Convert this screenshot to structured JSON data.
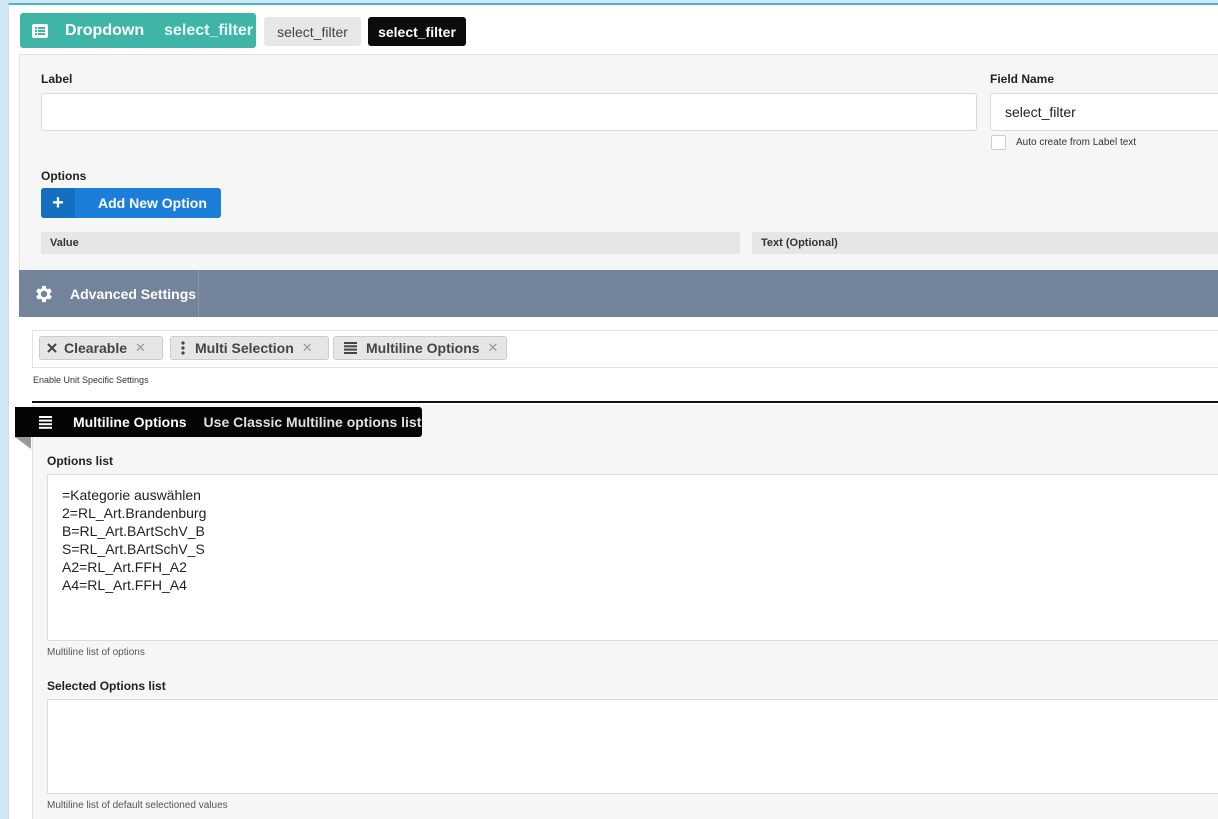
{
  "header": {
    "type_label": "Dropdown",
    "type_name": "select_filter",
    "tag_gray": "select_filter",
    "tag_black": "select_filter",
    "type_icon": "list-icon"
  },
  "form": {
    "label_title": "Label",
    "label_value": "",
    "field_name_title": "Field Name",
    "field_name_value": "select_filter",
    "auto_create_label": "Auto create from Label text",
    "auto_create_checked": false,
    "options_title": "Options",
    "add_option_label": "Add New Option",
    "add_option_icon": "plus-icon",
    "col_value": "Value",
    "col_text": "Text (Optional)"
  },
  "advanced": {
    "title": "Advanced Settings",
    "icon": "gear-icon",
    "chips": [
      {
        "label": "Clearable",
        "icon": "x-icon"
      },
      {
        "label": "Multi Selection",
        "icon": "vertical-dots-icon"
      },
      {
        "label": "Multiline Options",
        "icon": "lines-icon"
      }
    ],
    "chip_remove": "✕",
    "unit_settings_hint": "Enable Unit Specific Settings"
  },
  "multiline": {
    "tab_title": "Multiline Options",
    "tab_subtitle": "Use Classic Multiline options list",
    "tab_icon": "lines-icon",
    "options_list_title": "Options list",
    "options_lines": [
      "=Kategorie auswählen",
      "2=RL_Art.Brandenburg",
      "B=RL_Art.BArtSchV_B",
      "S=RL_Art.BArtSchV_S",
      "A2=RL_Art.FFH_A2",
      "A4=RL_Art.FFH_A4"
    ],
    "options_hint": "Multiline list of options",
    "selected_title": "Selected Options list",
    "selected_value": "",
    "selected_hint": "Multiline list of default selectioned values"
  },
  "colors": {
    "header_teal": "#3fb5a8",
    "add_button_blue": "#1b7fd9",
    "advanced_bar": "#73839a",
    "top_border": "#46b7cf"
  }
}
